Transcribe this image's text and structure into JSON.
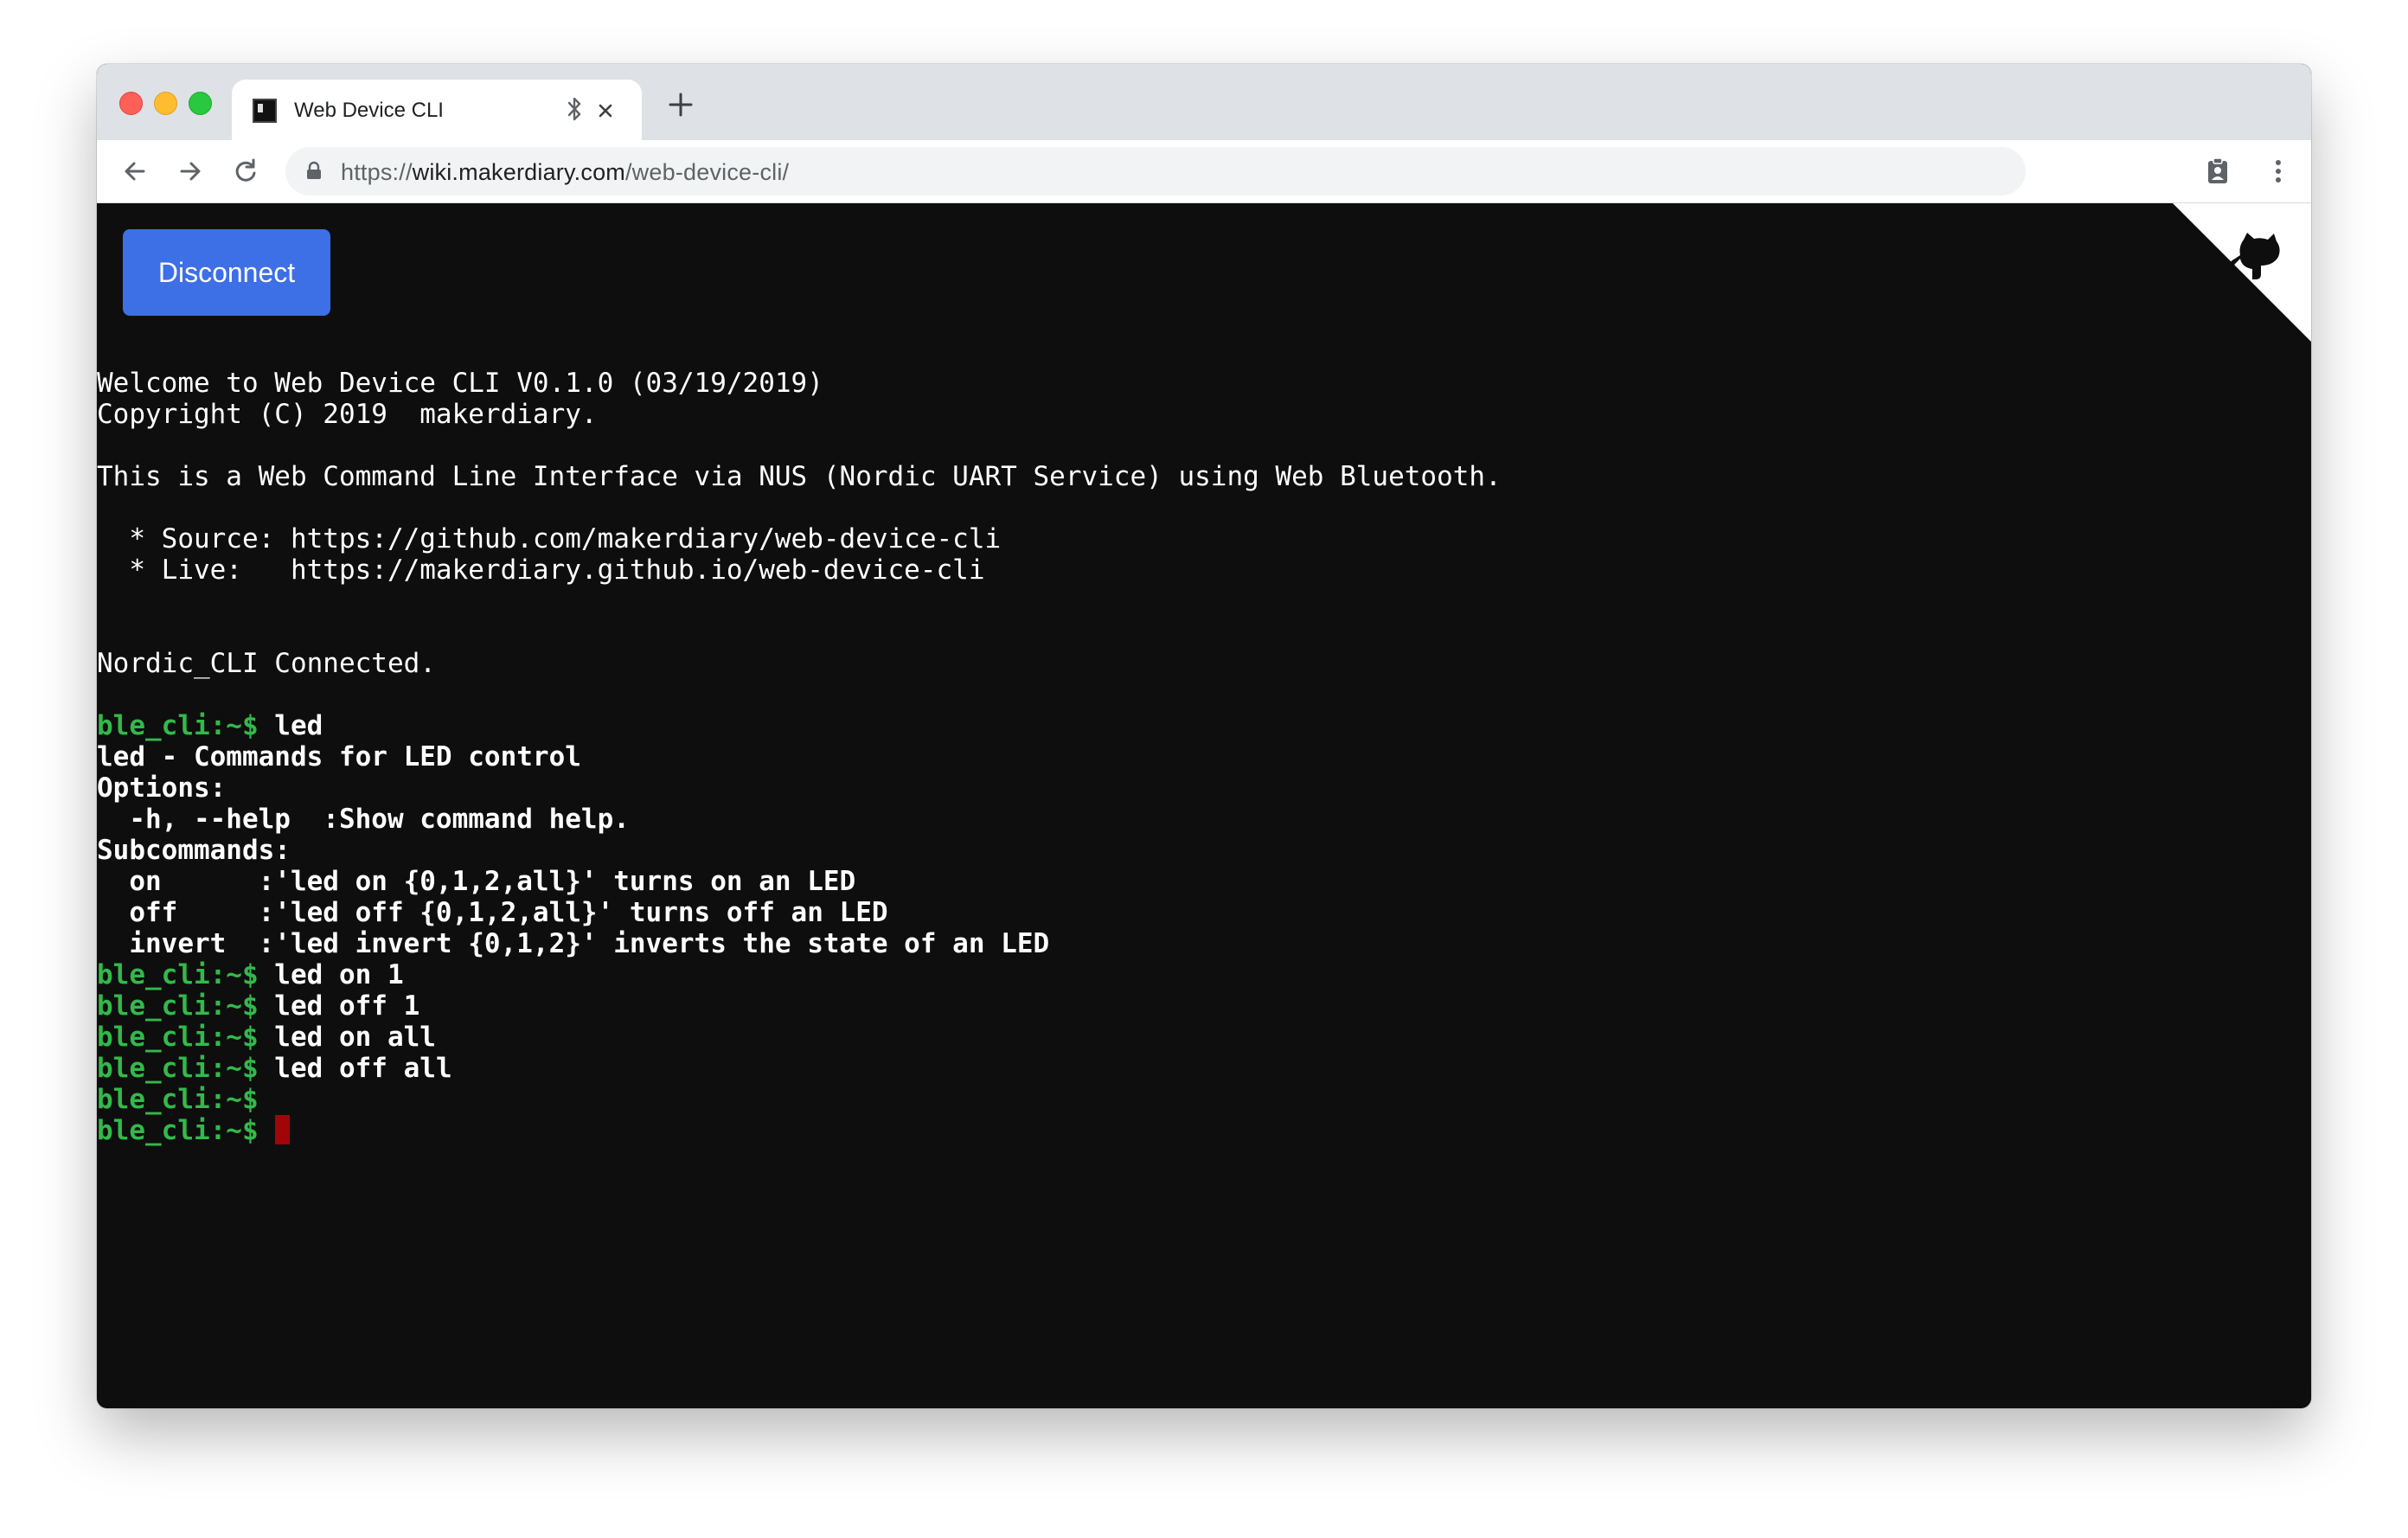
{
  "browser": {
    "tab": {
      "title": "Web Device CLI"
    },
    "url": {
      "scheme": "https://",
      "host": "wiki.makerdiary.com",
      "path": "/web-device-cli/"
    }
  },
  "page": {
    "disconnect_label": "Disconnect"
  },
  "terminal": {
    "prompt": "ble_cli:~$",
    "lines": [
      {
        "text": "Welcome to Web Device CLI V0.1.0 (03/19/2019)"
      },
      {
        "text": "Copyright (C) 2019  makerdiary."
      },
      {
        "text": ""
      },
      {
        "text": "This is a Web Command Line Interface via NUS (Nordic UART Service) using Web Bluetooth."
      },
      {
        "text": ""
      },
      {
        "text": "  * Source: https://github.com/makerdiary/web-device-cli"
      },
      {
        "text": "  * Live:   https://makerdiary.github.io/web-device-cli"
      },
      {
        "text": ""
      },
      {
        "text": ""
      },
      {
        "text": "Nordic_CLI Connected."
      },
      {
        "text": ""
      },
      {
        "prompt": true,
        "text": " led"
      },
      {
        "bold": true,
        "text": "led - Commands for LED control"
      },
      {
        "bold": true,
        "text": "Options:"
      },
      {
        "bold": true,
        "text": "  -h, --help  :Show command help."
      },
      {
        "bold": true,
        "text": "Subcommands:"
      },
      {
        "bold": true,
        "text": "  on      :'led on {0,1,2,all}' turns on an LED"
      },
      {
        "bold": true,
        "text": "  off     :'led off {0,1,2,all}' turns off an LED"
      },
      {
        "bold": true,
        "text": "  invert  :'led invert {0,1,2}' inverts the state of an LED"
      },
      {
        "prompt": true,
        "text": " led on 1"
      },
      {
        "prompt": true,
        "text": " led off 1"
      },
      {
        "prompt": true,
        "text": " led on all"
      },
      {
        "prompt": true,
        "text": " led off all"
      },
      {
        "prompt": true,
        "text": ""
      },
      {
        "prompt": true,
        "text": " ",
        "cursor": true
      }
    ]
  },
  "icons": {
    "favicon": "terminal-icon",
    "tab_bluetooth": "bluetooth-icon",
    "tab_close": "close-icon",
    "new_tab": "plus-icon",
    "back": "arrow-left-icon",
    "forward": "arrow-right-icon",
    "reload": "reload-icon",
    "lock": "lock-icon",
    "extension": "clipboard-badge-icon",
    "menu": "kebab-menu-icon",
    "github_corner": "github-octocat-icon"
  },
  "colors": {
    "terminal_bg": "#0e0e0e",
    "terminal_fg": "#ffffff",
    "prompt": "#33b94a",
    "cursor": "#a1050a",
    "button": "#3d6fe6"
  }
}
